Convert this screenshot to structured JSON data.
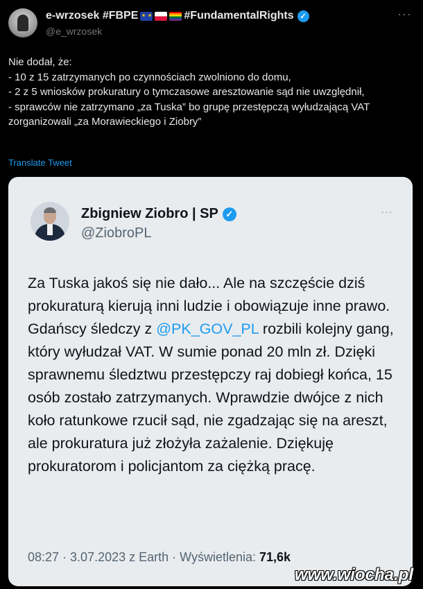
{
  "author": {
    "name_prefix": "e-wrzosek #FBPE",
    "name_suffix": "#FundamentalRights",
    "handle": "@e_wrzosek",
    "more": "···"
  },
  "tweet": {
    "text": "Nie dodał, że:\n- 10 z 15 zatrzymanych po czynnościach zwolniono do domu,\n- 2 z 5 wniosków prokuratury o tymczasowe aresztowanie sąd nie uwzględnił,\n- sprawców nie zatrzymano „za Tuska” bo grupę przestępczą wyłudzającą VAT zorganizowali „za Morawieckiego i Ziobry”",
    "translate": "Translate Tweet"
  },
  "quoted": {
    "name": "Zbigniew Ziobro | SP",
    "handle": "@ZiobroPL",
    "more": "···",
    "text_before": "Za Tuska jakoś się nie dało... Ale na szczęście dziś prokuraturą kierują inni ludzie i obowiązuje inne prawo. Gdańscy śledczy z ",
    "mention": "@PK_GOV_PL",
    "text_after": " rozbili kolejny gang, który wyłudzał VAT. W sumie ponad 20 mln zł. Dzięki sprawnemu śledztwu przestępczy raj dobiegł końca, 15 osób zostało zatrzymanych. Wprawdzie dwójce z nich koło ratunkowe rzucił sąd, nie zgadzając się na areszt, ale prokuratura już złożyła zażalenie. Dziękuję prokuratorom i policjantom za ciężką pracę.",
    "meta": "08:27 · 3.07.2023 z Earth · Wyświetlenia: ",
    "views": "71,6k"
  },
  "watermark": "www.wiocha.pl",
  "colors": {
    "accent": "#1d9bf0",
    "card_bg": "#e9ecef"
  }
}
